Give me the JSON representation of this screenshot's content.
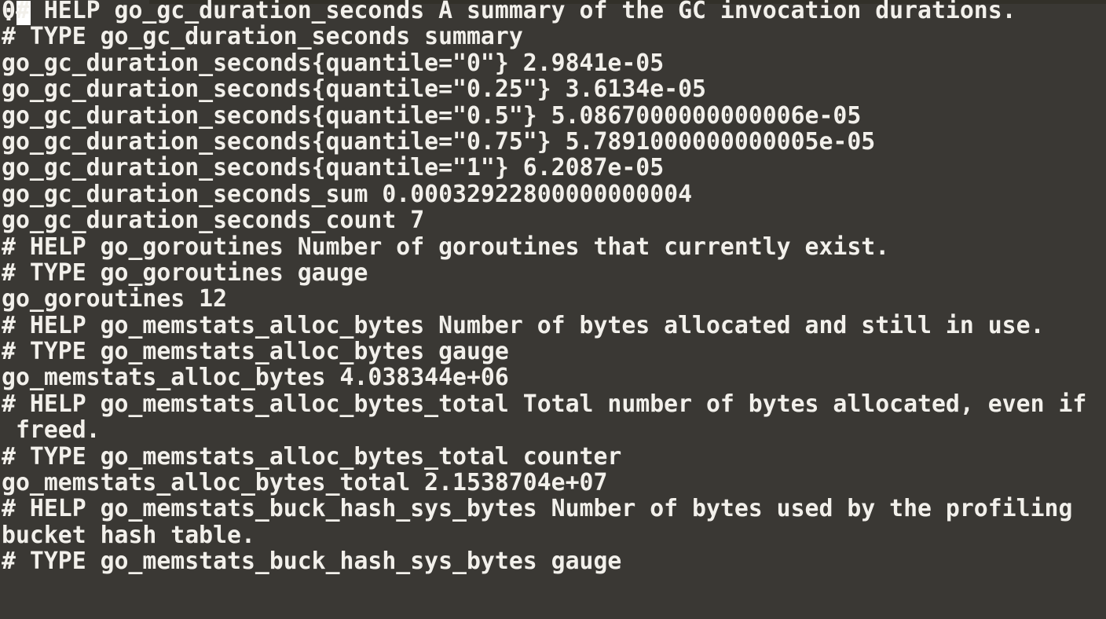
{
  "terminal": {
    "app": "pager-prometheus-metrics",
    "colors": {
      "background": "#3a3834",
      "foreground": "#f2f0eb",
      "cursor": "#ffffff",
      "scroll_remnant": "#323029"
    },
    "lines": [
      "0# HELP go_gc_duration_seconds A summary of the GC invocation durations.",
      "# TYPE go_gc_duration_seconds summary",
      "go_gc_duration_seconds{quantile=\"0\"} 2.9841e-05",
      "go_gc_duration_seconds{quantile=\"0.25\"} 3.6134e-05",
      "go_gc_duration_seconds{quantile=\"0.5\"} 5.0867000000000006e-05",
      "go_gc_duration_seconds{quantile=\"0.75\"} 5.7891000000000005e-05",
      "go_gc_duration_seconds{quantile=\"1\"} 6.2087e-05",
      "go_gc_duration_seconds_sum 0.00032922800000000004",
      "go_gc_duration_seconds_count 7",
      "# HELP go_goroutines Number of goroutines that currently exist.",
      "# TYPE go_goroutines gauge",
      "go_goroutines 12",
      "# HELP go_memstats_alloc_bytes Number of bytes allocated and still in use.",
      "# TYPE go_memstats_alloc_bytes gauge",
      "go_memstats_alloc_bytes 4.038344e+06",
      "# HELP go_memstats_alloc_bytes_total Total number of bytes allocated, even if",
      " freed.",
      "# TYPE go_memstats_alloc_bytes_total counter",
      "go_memstats_alloc_bytes_total 2.1538704e+07",
      "# HELP go_memstats_buck_hash_sys_bytes Number of bytes used by the profiling",
      "bucket hash table.",
      "# TYPE go_memstats_buck_hash_sys_bytes gauge"
    ],
    "prompt": {
      "symbol": ":",
      "cursor_visible": true
    }
  }
}
